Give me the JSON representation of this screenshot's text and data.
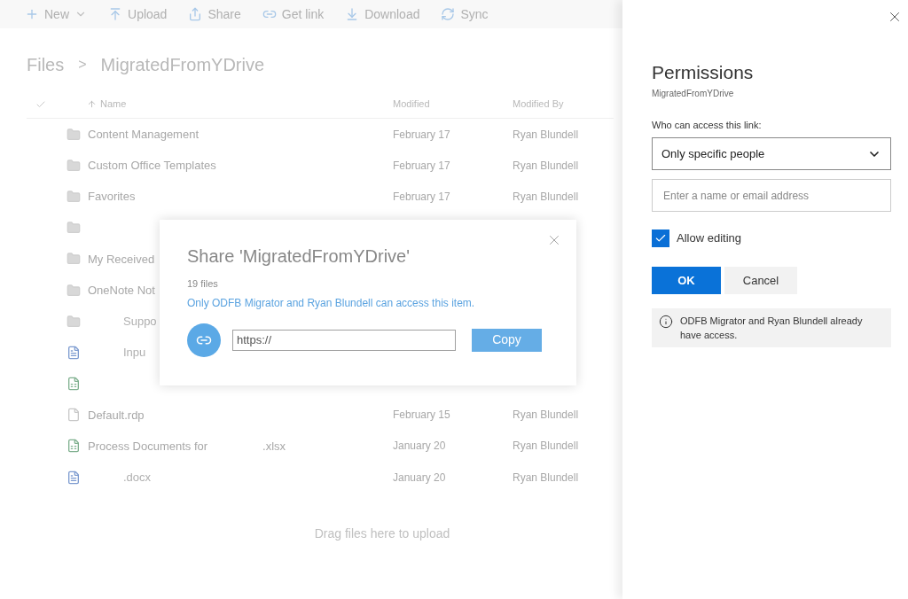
{
  "toolbar": [
    {
      "kind": "new",
      "label": "New"
    },
    {
      "kind": "upload",
      "label": "Upload"
    },
    {
      "kind": "share",
      "label": "Share"
    },
    {
      "kind": "link",
      "label": "Get link"
    },
    {
      "kind": "download",
      "label": "Download"
    },
    {
      "kind": "sync",
      "label": "Sync"
    }
  ],
  "breadcrumb": [
    "Files",
    "MigratedFromYDrive"
  ],
  "breadcrumb_separator": ">",
  "columns": {
    "name": "Name",
    "modified": "Modified",
    "modified_by": "Modified By"
  },
  "rows": [
    {
      "kind": "folder",
      "name": "Content Management",
      "modified": "February 17",
      "modified_by": "Ryan Blundell"
    },
    {
      "kind": "folder",
      "name": "Custom Office Templates",
      "modified": "February 17",
      "modified_by": "Ryan Blundell"
    },
    {
      "kind": "folder",
      "name": "Favorites",
      "modified": "February 17",
      "modified_by": "Ryan Blundell"
    },
    {
      "kind": "folder"
    },
    {
      "kind": "folder",
      "name": "My Received"
    },
    {
      "kind": "folder",
      "name": "OneNote Not"
    },
    {
      "kind": "folder",
      "indented": true,
      "name": "Suppo"
    },
    {
      "kind": "word",
      "indented": true,
      "name": "Inpu"
    },
    {
      "kind": "excel"
    },
    {
      "kind": "file",
      "name": "Default.rdp",
      "modified": "February 15",
      "modified_by": "Ryan Blundell"
    },
    {
      "kind": "excel",
      "name": "Process Documents for",
      "suffix": ".xlsx",
      "modified": "January 20",
      "modified_by": "Ryan Blundell"
    },
    {
      "kind": "word",
      "indented": true,
      "name": ".docx",
      "modified": "January 20",
      "modified_by": "Ryan Blundell"
    }
  ],
  "drop_hint": "Drag files here to upload",
  "share_dialog": {
    "title": "Share 'MigratedFromYDrive'",
    "count": "19 files",
    "access": "Only ODFB Migrator and Ryan Blundell can access this item.",
    "link_value": "https://",
    "copy": "Copy"
  },
  "permissions": {
    "title": "Permissions",
    "subtitle": "MigratedFromYDrive",
    "label": "Who can access this link:",
    "select_value": "Only specific people",
    "people_placeholder": "Enter a name or email address",
    "allow_editing": {
      "label": "Allow editing",
      "checked": true
    },
    "ok": "OK",
    "cancel": "Cancel",
    "info": "ODFB Migrator and Ryan Blundell already have access."
  }
}
